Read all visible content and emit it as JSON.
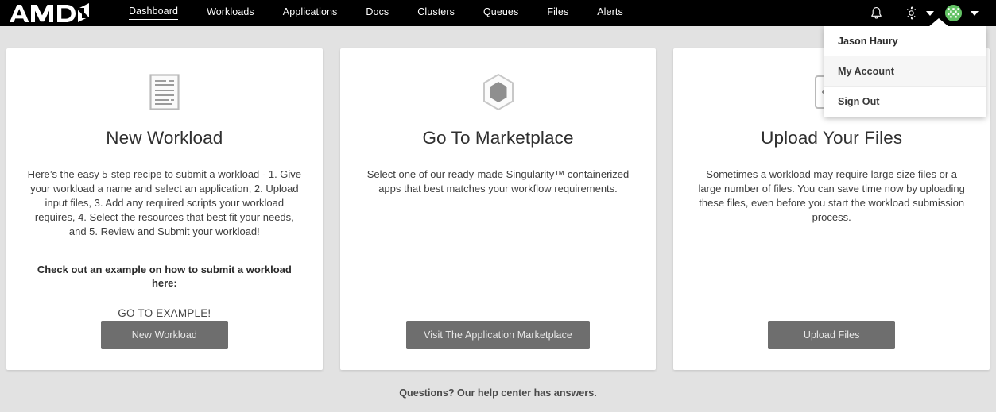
{
  "brand": {
    "logo_text": "AMD",
    "logo_icon": "amd-arrow-logo"
  },
  "nav": {
    "items": [
      {
        "label": "Dashboard",
        "active": true
      },
      {
        "label": "Workloads",
        "active": false
      },
      {
        "label": "Applications",
        "active": false
      },
      {
        "label": "Docs",
        "active": false
      },
      {
        "label": "Clusters",
        "active": false
      },
      {
        "label": "Queues",
        "active": false
      },
      {
        "label": "Files",
        "active": false
      },
      {
        "label": "Alerts",
        "active": false
      }
    ]
  },
  "topbar_right": {
    "notifications_icon": "bell-icon",
    "settings_icon": "gear-icon",
    "settings_caret_icon": "chevron-down-icon",
    "avatar_icon": "user-avatar-identicon",
    "avatar_color": "#63c264",
    "user_caret_icon": "chevron-down-icon"
  },
  "user_menu": {
    "open": true,
    "user_name": "Jason Haury",
    "items": [
      {
        "label": "My Account",
        "hovered": true
      },
      {
        "label": "Sign Out",
        "hovered": false
      }
    ]
  },
  "cards": [
    {
      "icon": "document-lines-icon",
      "title": "New Workload",
      "description": "Here’s the easy 5-step recipe to submit a workload - 1. Give your workload a name and select an application, 2. Upload input files, 3. Add any required scripts your workload requires, 4. Select the resources that best fit your needs, and 5. Review and Submit your workload!",
      "sub_bold": "Check out an example on how to submit a workload here:",
      "link": "GO TO EXAMPLE!",
      "button": "New Workload"
    },
    {
      "icon": "hexagon-icon",
      "title": "Go To Marketplace",
      "description": "Select one of our ready-made Singularity™ containerized apps that best matches your workflow requirements.",
      "sub_bold": "",
      "link": "",
      "button": "Visit The Application Marketplace"
    },
    {
      "icon": "upload-box-arrow-icon",
      "title": "Upload Your Files",
      "description": "Sometimes a workload may require large size files or a large number of files. You can save time now by uploading these files, even before you start the workload submission process.",
      "sub_bold": "",
      "link": "",
      "button": "Upload Files"
    }
  ],
  "footer": {
    "text": "Questions? Our help center has answers."
  },
  "colors": {
    "header_bg": "#000000",
    "page_bg": "#e2e2e2",
    "card_bg": "#ffffff",
    "button_bg": "#6e6e6e",
    "accent_avatar": "#63c264"
  }
}
